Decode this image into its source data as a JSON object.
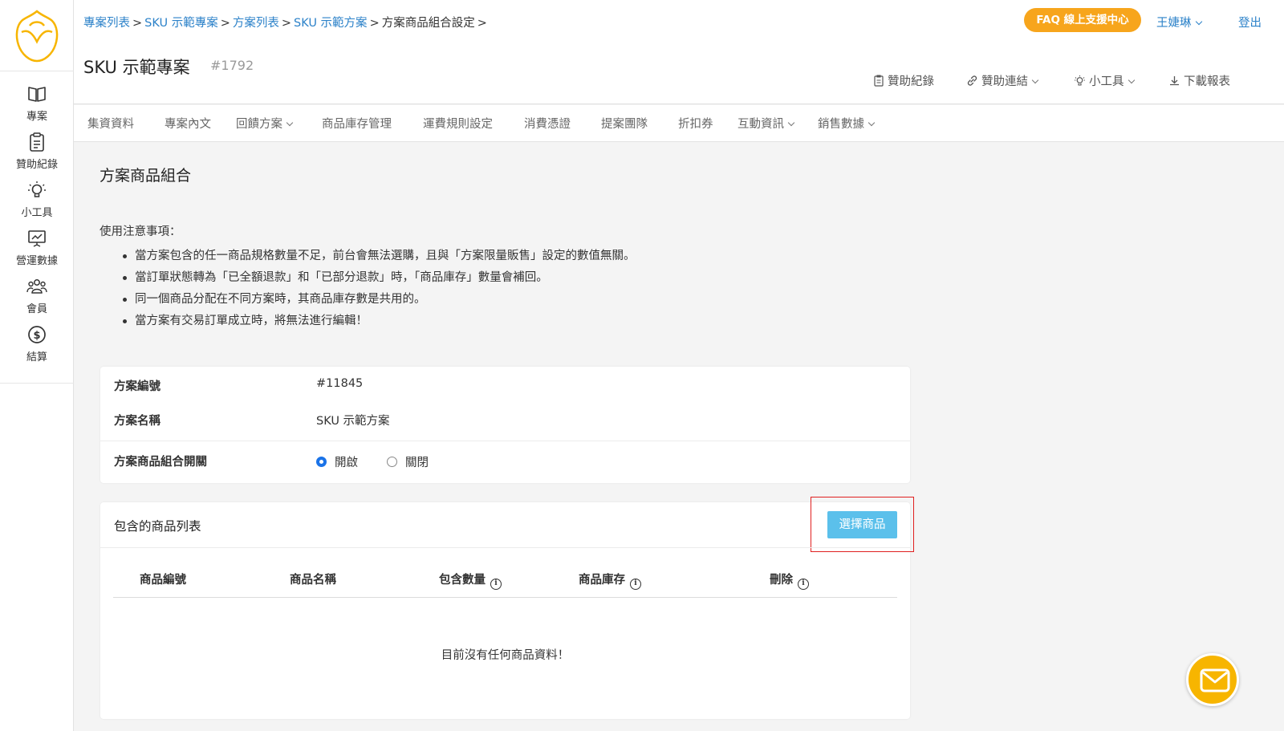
{
  "colors": {
    "brand": "#f7b500",
    "link": "#2c82c9",
    "faq": "#f7a51c",
    "primary_button": "#5bc0eb",
    "highlight": "#e02020",
    "radio_selected": "#1a73e8"
  },
  "sidebar": {
    "items": [
      {
        "label": "專案",
        "icon": "book-icon"
      },
      {
        "label": "贊助紀錄",
        "icon": "clipboard-icon"
      },
      {
        "label": "小工具",
        "icon": "lightbulb-icon"
      },
      {
        "label": "營運數據",
        "icon": "chart-board-icon"
      },
      {
        "label": "會員",
        "icon": "users-icon"
      },
      {
        "label": "結算",
        "icon": "dollar-icon"
      }
    ]
  },
  "header": {
    "breadcrumb": [
      "專案列表",
      "SKU 示範專案",
      "方案列表",
      "SKU 示範方案",
      "方案商品組合設定"
    ],
    "title": "SKU 示範專案",
    "project_id": "#1792",
    "faq": "FAQ 線上支援中心",
    "user": "王婕琳",
    "logout": "登出",
    "tools": [
      "贊助紀錄",
      "贊助連結",
      "小工具",
      "下載報表"
    ]
  },
  "tabs": [
    "集資資料",
    "專案內文",
    "回饋方案",
    "商品庫存管理",
    "運費規則設定",
    "消費憑證",
    "提案團隊",
    "折扣券",
    "互動資訊",
    "銷售數據"
  ],
  "main": {
    "section_title": "方案商品組合",
    "notes_title": "使用注意事項：",
    "notes": [
      "當方案包含的任一商品規格數量不足，前台會無法選購，且與「方案限量販售」設定的數值無關。",
      "當訂單狀態轉為「已全額退款」和「已部分退款」時，「商品庫存」數量會補回。",
      "同一個商品分配在不同方案時，其商品庫存數是共用的。",
      "當方案有交易訂單成立時，將無法進行編輯！"
    ],
    "info": {
      "plan_no_label": "方案編號",
      "plan_no": "#11845",
      "plan_name_label": "方案名稱",
      "plan_name": "SKU 示範方案",
      "toggle_label": "方案商品組合開關",
      "on_label": "開啟",
      "off_label": "關閉",
      "selected": "開啟"
    },
    "list": {
      "title": "包含的商品列表",
      "select_button": "選擇商品",
      "columns": [
        "商品編號",
        "商品名稱",
        "包含數量",
        "商品庫存",
        "刪除"
      ],
      "empty": "目前沒有任何商品資料！"
    }
  }
}
